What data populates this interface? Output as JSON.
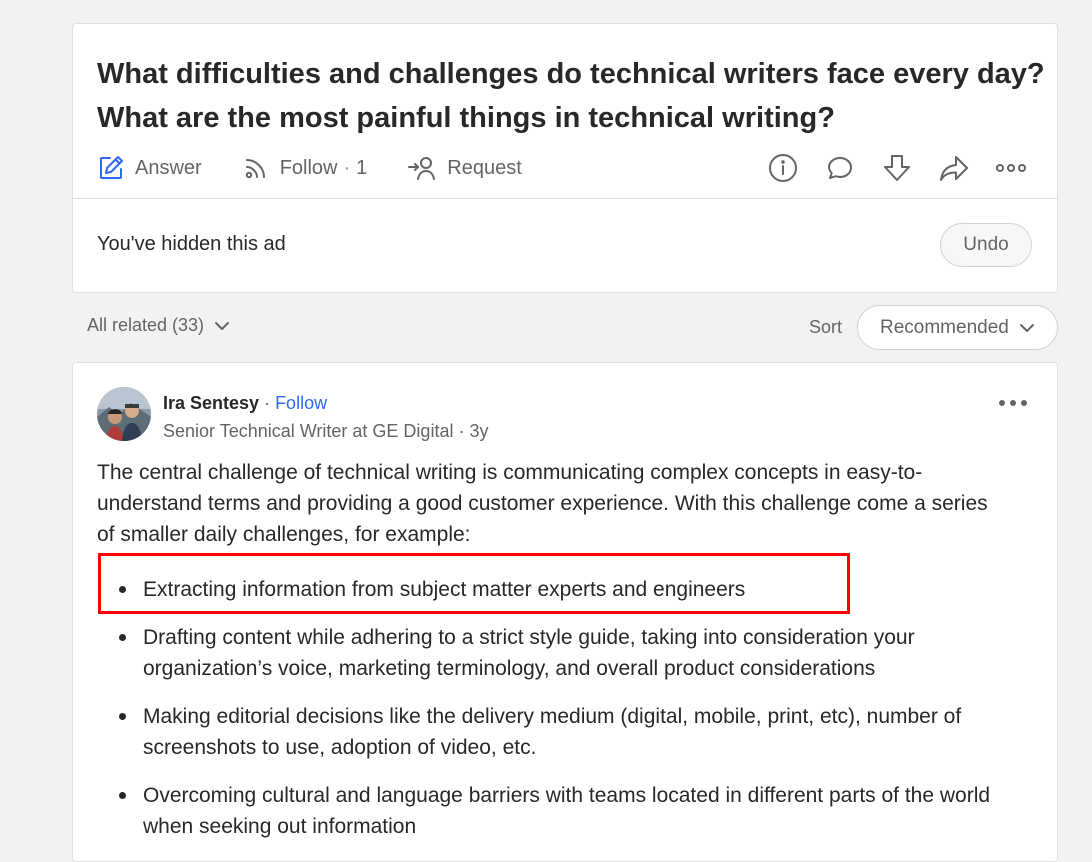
{
  "question": {
    "title": "What difficulties and challenges do technical writers face every day? What are the most painful things in technical writing?",
    "actions": {
      "answer_label": "Answer",
      "follow_label": "Follow",
      "follow_separator": "·",
      "follow_count": "1",
      "request_label": "Request"
    },
    "icons": [
      "info-icon",
      "comment-icon",
      "downvote-icon",
      "share-icon",
      "more-icon"
    ]
  },
  "ad": {
    "hidden_text": "You've hidden this ad",
    "undo_label": "Undo"
  },
  "filters": {
    "all_related_label": "All related (33)",
    "sort_label": "Sort",
    "sort_value": "Recommended"
  },
  "answer": {
    "author_name": "Ira Sentesy",
    "separator": "·",
    "follow_label": "Follow",
    "credential": "Senior Technical Writer at GE Digital · 3y",
    "intro": "The central challenge of technical writing is communicating complex concepts in easy-to-understand terms and providing a good customer experience. With this challenge come a series of smaller daily challenges, for example:",
    "bullets": [
      "Extracting information from subject matter experts and engineers",
      "Drafting content while adhering to a strict style guide, taking into consideration your organization’s voice, marketing terminology, and overall product considerations",
      "Making editorial decisions like the delivery medium (digital, mobile, print, etc), number of screenshots to use, adoption of video, etc.",
      "Overcoming cultural and language barriers with teams located in different parts of the world when seeking out information"
    ]
  },
  "colors": {
    "accent_blue": "#2e69ff",
    "highlight_red": "#ff0000",
    "page_bg": "#f1f2f2",
    "text_primary": "#282829",
    "text_secondary": "#636466"
  }
}
